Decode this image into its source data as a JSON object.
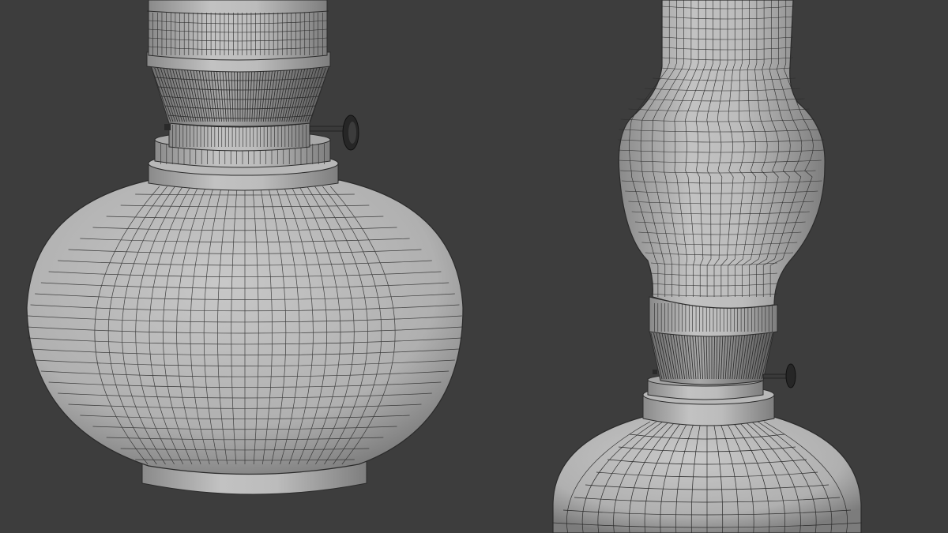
{
  "viewport": {
    "background": "#3d3d3d",
    "mesh_fill": "#b4b4b4",
    "mesh_fill_dark": "#7a7a7a",
    "wire_color": "#2b2b2b",
    "knob_color": "#222222"
  },
  "objects": [
    {
      "name": "oil-lamp-closeup",
      "parts": [
        "chimney-collar",
        "burner-gallery",
        "burner-band",
        "wick-knob",
        "neck-ring",
        "font-body",
        "base-foot"
      ]
    },
    {
      "name": "oil-lamp-full",
      "parts": [
        "glass-chimney",
        "chimney-collar",
        "burner-gallery",
        "wick-knob",
        "neck-ring",
        "font-body"
      ]
    }
  ]
}
